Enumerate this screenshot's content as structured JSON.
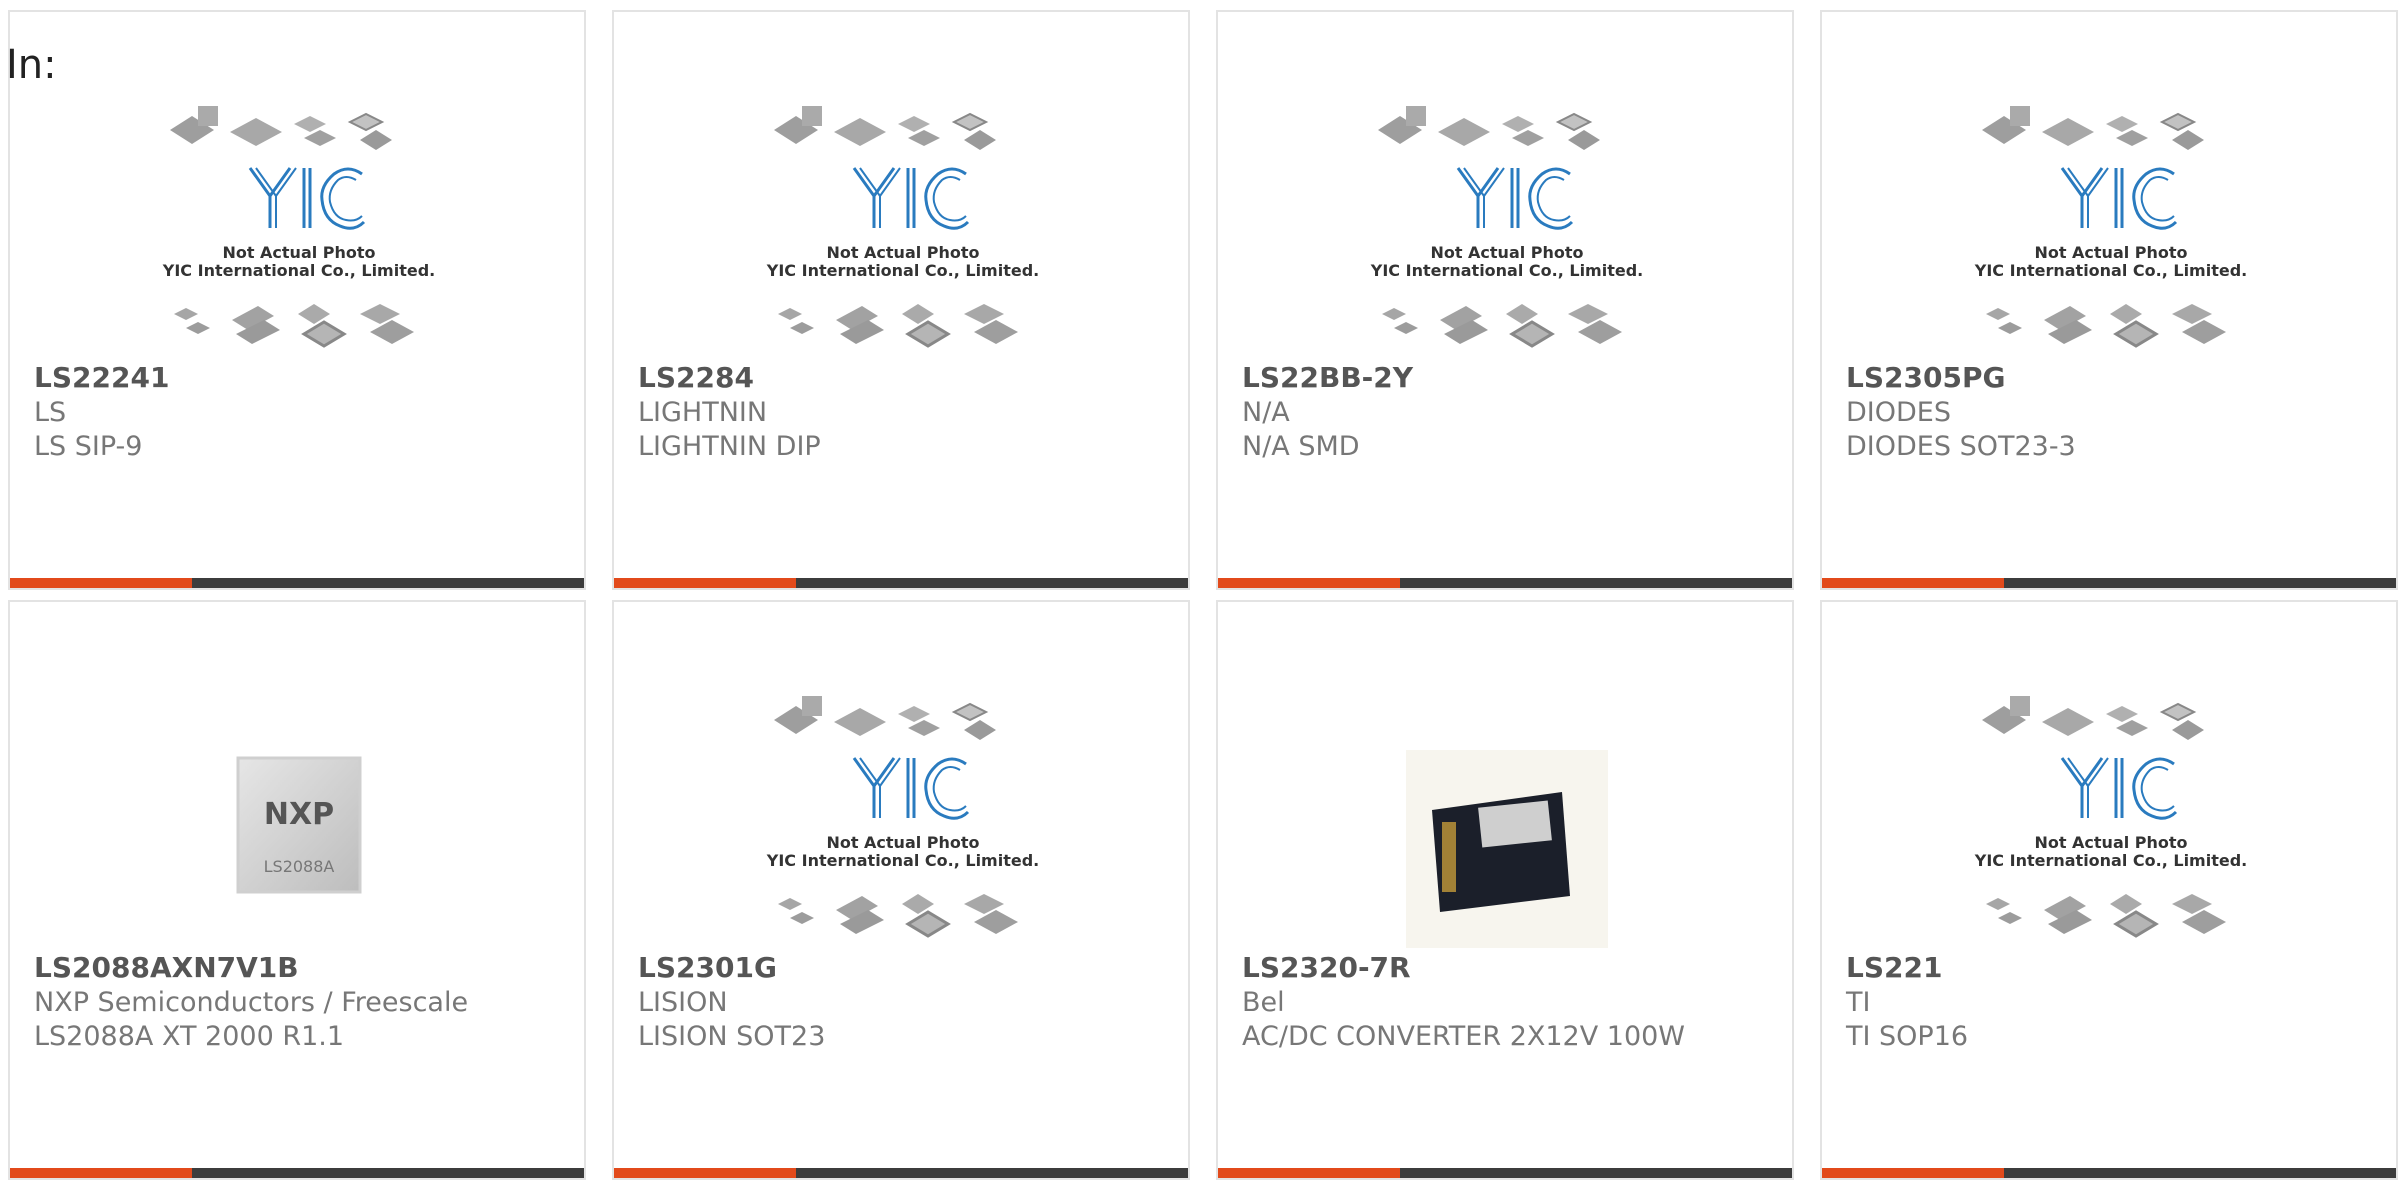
{
  "header": {
    "label": "In:"
  },
  "colors": {
    "accent": "#e24a1b",
    "bar": "#3c3c3c",
    "logo": "#2a7bbf"
  },
  "placeholder": {
    "line1": "Not Actual Photo",
    "line2": "YIC International Co., Limited."
  },
  "products": [
    {
      "part": "LS22241",
      "brand": "LS",
      "desc": "LS SIP-9",
      "image": "yic-placeholder"
    },
    {
      "part": "LS2284",
      "brand": "LIGHTNIN",
      "desc": "LIGHTNIN DIP",
      "image": "yic-placeholder"
    },
    {
      "part": "LS22BB-2Y",
      "brand": "N/A",
      "desc": "N/A SMD",
      "image": "yic-placeholder"
    },
    {
      "part": "LS2305PG",
      "brand": "DIODES",
      "desc": "DIODES SOT23-3",
      "image": "yic-placeholder"
    },
    {
      "part": "LS2088AXN7V1B",
      "brand": "NXP Semiconductors / Freescale",
      "desc": "LS2088A XT 2000 R1.1",
      "image": "nxp-chip",
      "chip_logo": "NXP",
      "chip_mark": "LS2088A"
    },
    {
      "part": "LS2301G",
      "brand": "LISION",
      "desc": "LISION SOT23",
      "image": "yic-placeholder"
    },
    {
      "part": "LS2320-7R",
      "brand": "Bel",
      "desc": "AC/DC CONVERTER 2X12V 100W",
      "image": "power-converter"
    },
    {
      "part": "LS221",
      "brand": "TI",
      "desc": "TI SOP16",
      "image": "yic-placeholder"
    }
  ]
}
